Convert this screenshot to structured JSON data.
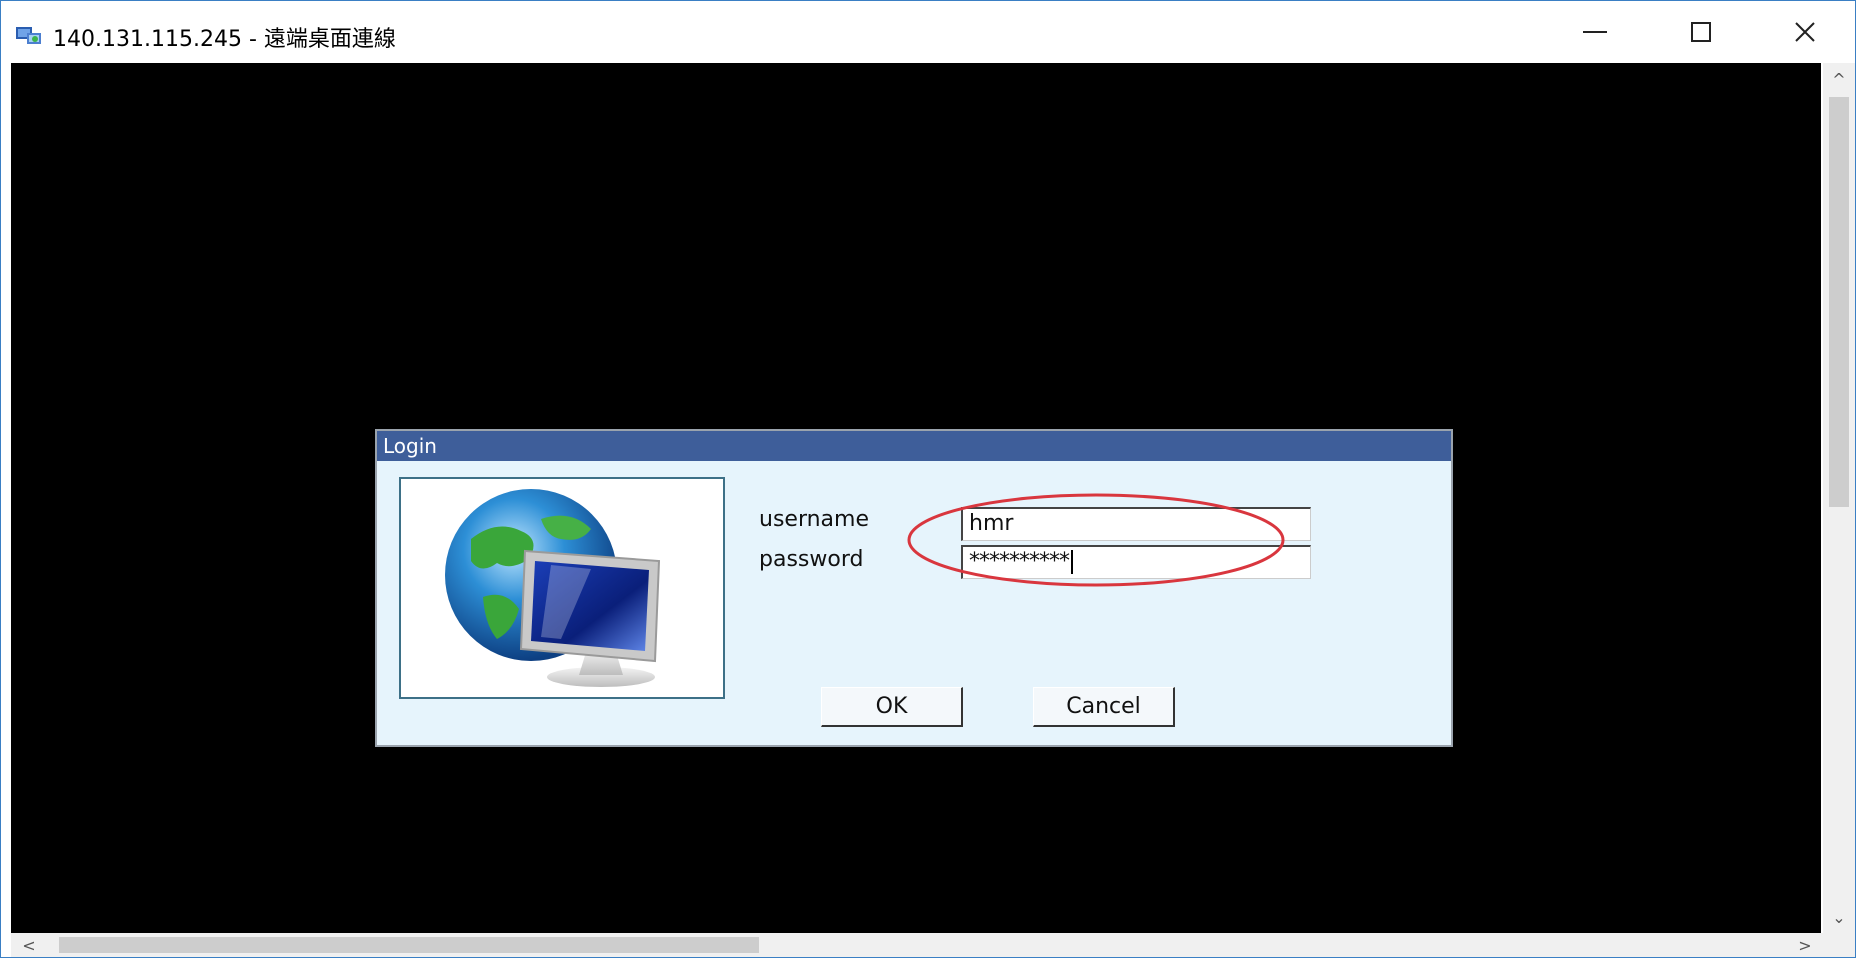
{
  "window": {
    "title": "140.131.115.245 - 遠端桌面連線",
    "controls": {
      "minimize_symbol": "—",
      "maximize_symbol": "☐",
      "close_symbol": "✕"
    }
  },
  "dialog": {
    "title": "Login",
    "username_label": "username",
    "password_label": "password",
    "username_value": "hmr",
    "password_value": "**********",
    "ok_label": "OK",
    "cancel_label": "Cancel",
    "image_icon": "globe-monitor-icon"
  },
  "scrollbars": {
    "up_symbol": "^",
    "down_symbol": "⌄",
    "left_symbol": "<",
    "right_symbol": ">"
  },
  "colors": {
    "dialog_title_bar": "#3e5e9a",
    "dialog_background": "#e6f4fc",
    "highlight_ellipse": "#d9363e",
    "remote_background": "#000000"
  }
}
